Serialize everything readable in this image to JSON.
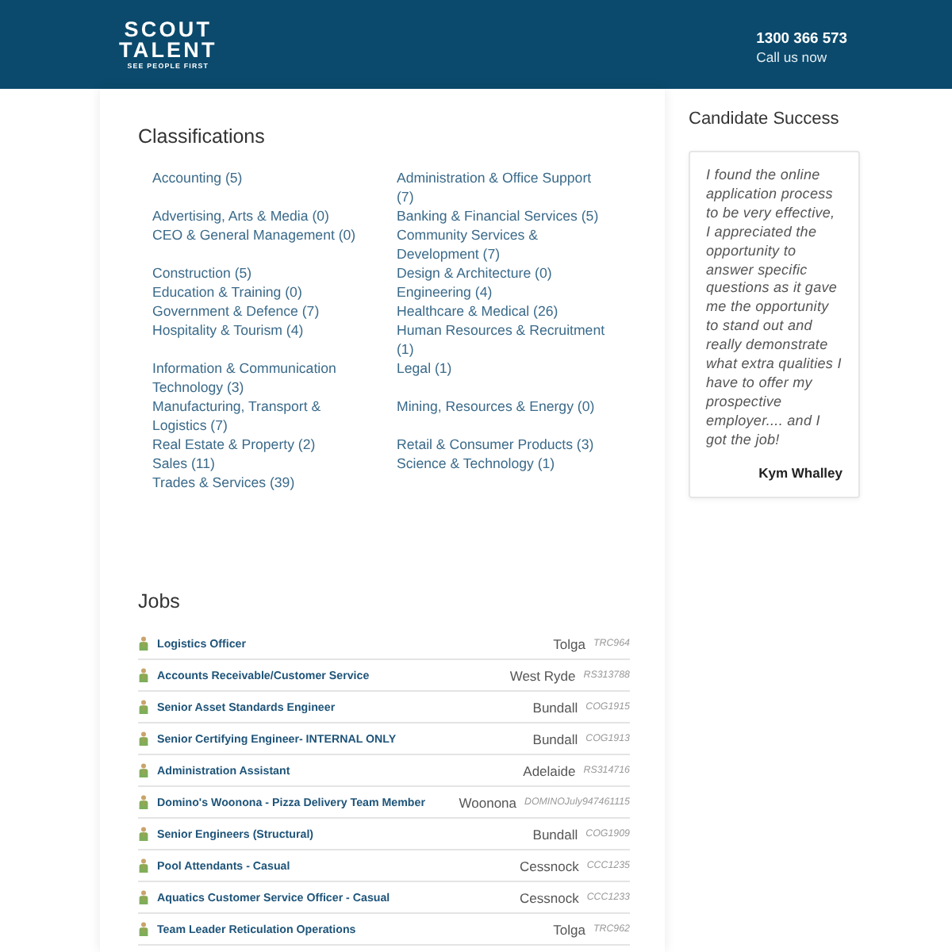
{
  "header": {
    "logo": {
      "line_1": "SCOUT",
      "line_2": "TALENT",
      "tagline": "SEE PEOPLE FIRST"
    },
    "phone": "1300 366 573",
    "call_label": "Call us now"
  },
  "classifications": {
    "title": "Classifications",
    "items": [
      "Accounting (5)",
      "Administration & Office Support (7)",
      "Advertising, Arts & Media (0)",
      "Banking & Financial Services (5)",
      "CEO & General Management (0)",
      "Community Services & Development (7)",
      "Construction (5)",
      "Design & Architecture (0)",
      "Education & Training (0)",
      "Engineering (4)",
      "Government & Defence (7)",
      "Healthcare & Medical (26)",
      "Hospitality & Tourism (4)",
      "Human Resources & Recruitment (1)",
      "Information & Communication Technology (3)",
      "Legal (1)",
      "Manufacturing, Transport & Logistics (7)",
      "Mining, Resources & Energy (0)",
      "Real Estate & Property (2)",
      "Retail & Consumer Products (3)",
      "Sales (11)",
      "Science & Technology (1)",
      "Trades & Services (39)"
    ]
  },
  "jobs": {
    "title": "Jobs",
    "rows": [
      {
        "title": "Logistics Officer",
        "location": "Tolga",
        "reference": "TRC964"
      },
      {
        "title": "Accounts Receivable/Customer Service",
        "location": "West Ryde",
        "reference": "RS313788"
      },
      {
        "title": "Senior Asset Standards Engineer",
        "location": "Bundall",
        "reference": "COG1915"
      },
      {
        "title": "Senior Certifying Engineer- INTERNAL ONLY",
        "location": "Bundall",
        "reference": "COG1913"
      },
      {
        "title": "Administration Assistant",
        "location": "Adelaide",
        "reference": "RS314716"
      },
      {
        "title": "Domino's Woonona - Pizza Delivery Team Member",
        "location": "Woonona",
        "reference": "DOMINOJuly947461115"
      },
      {
        "title": "Senior Engineers (Structural)",
        "location": "Bundall",
        "reference": "COG1909"
      },
      {
        "title": "Pool Attendants - Casual",
        "location": "Cessnock",
        "reference": "CCC1235"
      },
      {
        "title": "Aquatics Customer Service Officer - Casual",
        "location": "Cessnock",
        "reference": "CCC1233"
      },
      {
        "title": "Team Leader Reticulation Operations",
        "location": "Tolga",
        "reference": "TRC962"
      }
    ]
  },
  "candidate_success": {
    "title": "Candidate Success",
    "quote": "I found the online application process to be very effective, I appreciated the opportunity to answer specific questions as it gave me the opportunity to stand out and really demonstrate what extra qualities I have to offer my prospective employer.... and I got the job!",
    "author": "Kym Whalley"
  }
}
